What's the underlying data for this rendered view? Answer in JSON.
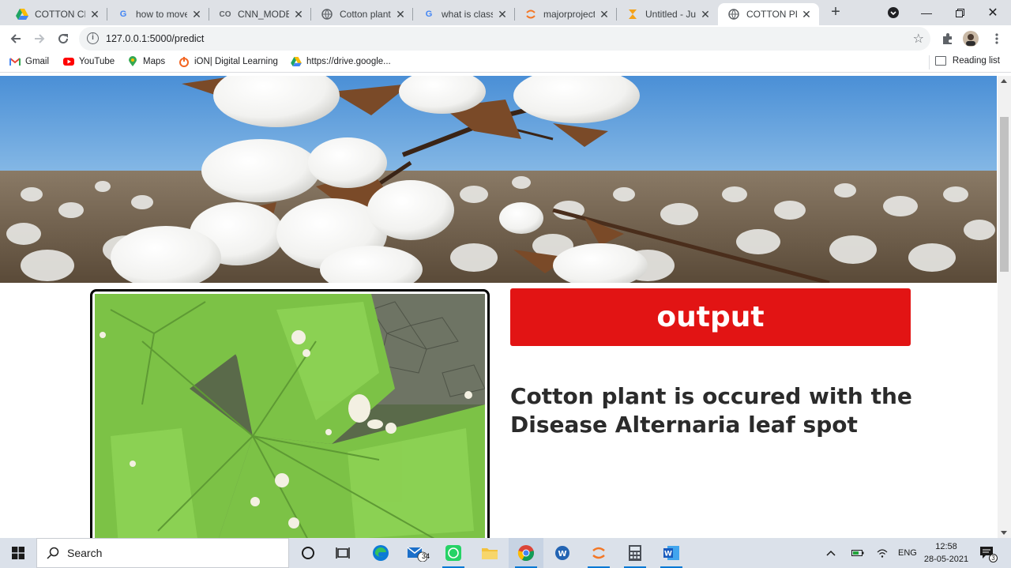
{
  "browser": {
    "tabs": [
      {
        "title": "COTTON CRO",
        "icon": "google-drive-icon",
        "active": false
      },
      {
        "title": "how to move",
        "icon": "google-icon",
        "active": false
      },
      {
        "title": "CNN_MODEL",
        "icon": "colab-icon",
        "active": false
      },
      {
        "title": "Cotton plant",
        "icon": "globe-icon",
        "active": false
      },
      {
        "title": "what is classif",
        "icon": "google-icon",
        "active": false
      },
      {
        "title": "majorproject/",
        "icon": "jupyter-icon",
        "active": false
      },
      {
        "title": "Untitled - Jup",
        "icon": "hourglass-icon",
        "active": false
      },
      {
        "title": "COTTON PLA",
        "icon": "globe-icon",
        "active": true
      }
    ],
    "address": "127.0.0.1:5000/predict",
    "bookmarks": [
      {
        "label": "Gmail",
        "icon": "gmail-icon"
      },
      {
        "label": "YouTube",
        "icon": "youtube-icon"
      },
      {
        "label": "Maps",
        "icon": "maps-icon"
      },
      {
        "label": "iON| Digital Learning",
        "icon": "ion-icon"
      },
      {
        "label": "https://drive.google...",
        "icon": "google-drive-icon"
      }
    ],
    "reading_list": "Reading list"
  },
  "page": {
    "output_label": "output",
    "result_text": "Cotton plant is occured with the Disease Alternaria leaf spot"
  },
  "taskbar": {
    "search_placeholder": "Search",
    "mail_badge": "34",
    "language": "ENG",
    "time": "12:58",
    "date": "28-05-2021",
    "notification_count": "3"
  },
  "colors": {
    "output_button": "#e21414",
    "tab_strip": "#dee1e6",
    "taskbar": "#dbe1ea"
  }
}
